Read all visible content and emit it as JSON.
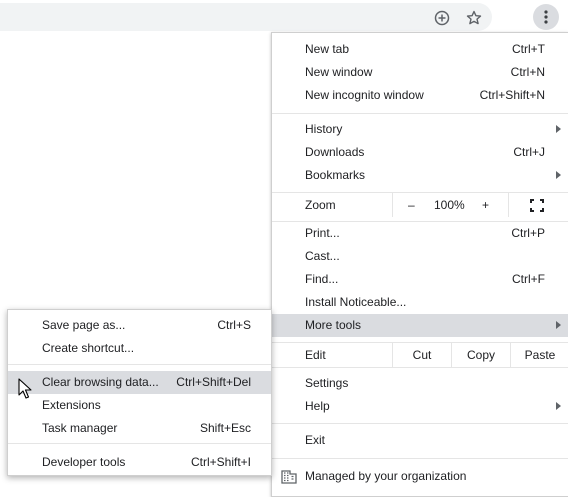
{
  "toolbar": {
    "icons": [
      "add-circle-icon",
      "star-icon",
      "more-vert-icon"
    ]
  },
  "menu": {
    "new_tab": {
      "label": "New tab",
      "shortcut": "Ctrl+T"
    },
    "new_window": {
      "label": "New window",
      "shortcut": "Ctrl+N"
    },
    "new_incognito": {
      "label": "New incognito window",
      "shortcut": "Ctrl+Shift+N"
    },
    "history": {
      "label": "History"
    },
    "downloads": {
      "label": "Downloads",
      "shortcut": "Ctrl+J"
    },
    "bookmarks": {
      "label": "Bookmarks"
    },
    "zoom": {
      "label": "Zoom",
      "minus": "–",
      "value": "100%",
      "plus": "+"
    },
    "print": {
      "label": "Print...",
      "shortcut": "Ctrl+P"
    },
    "cast": {
      "label": "Cast..."
    },
    "find": {
      "label": "Find...",
      "shortcut": "Ctrl+F"
    },
    "install": {
      "label": "Install Noticeable..."
    },
    "more_tools": {
      "label": "More tools"
    },
    "edit": {
      "label": "Edit",
      "cut": "Cut",
      "copy": "Copy",
      "paste": "Paste"
    },
    "settings": {
      "label": "Settings"
    },
    "help": {
      "label": "Help"
    },
    "exit": {
      "label": "Exit"
    },
    "managed": {
      "label": "Managed by your organization"
    }
  },
  "submenu": {
    "save_page": {
      "label": "Save page as...",
      "shortcut": "Ctrl+S"
    },
    "create_shortcut": {
      "label": "Create shortcut..."
    },
    "clear_browsing": {
      "label": "Clear browsing data...",
      "shortcut": "Ctrl+Shift+Del"
    },
    "extensions": {
      "label": "Extensions"
    },
    "task_manager": {
      "label": "Task manager",
      "shortcut": "Shift+Esc"
    },
    "developer_tools": {
      "label": "Developer tools",
      "shortcut": "Ctrl+Shift+I"
    }
  }
}
